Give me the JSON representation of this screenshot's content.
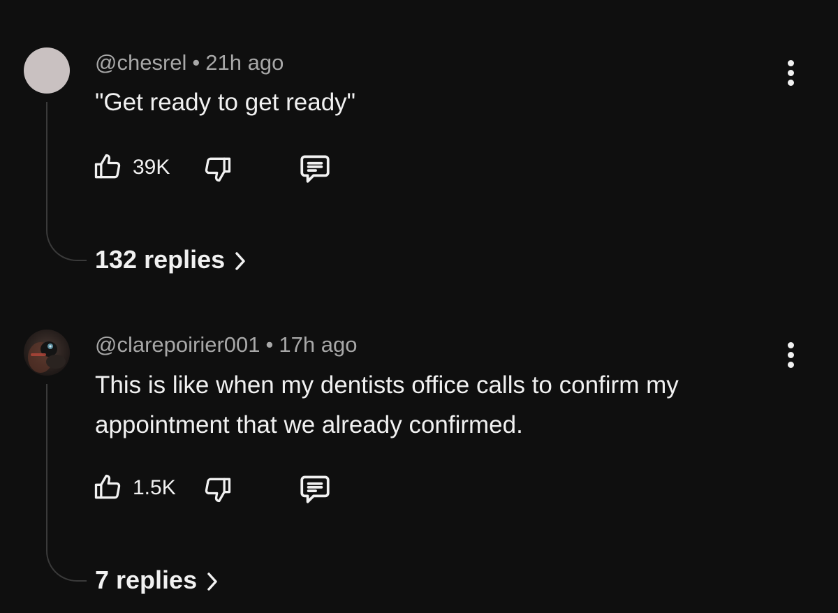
{
  "comments": [
    {
      "author": "@chesrel",
      "separator": "•",
      "time": "21h ago",
      "text": "\"Get ready to get ready\"",
      "likes": "39K",
      "replies_label": "132 replies",
      "avatar": "plain-avatar"
    },
    {
      "author": "@clarepoirier001",
      "separator": "•",
      "time": "17h ago",
      "text": "This is like when my dentists office calls to confirm my appointment that we already confirmed.",
      "likes": "1.5K",
      "replies_label": "7 replies",
      "avatar": "photo-avatar"
    }
  ],
  "icons": {
    "like": "thumbs-up-icon",
    "dislike": "thumbs-down-icon",
    "reply": "comment-icon",
    "more": "more-vertical-icon",
    "expand": "chevron-right-icon"
  },
  "colors": {
    "background": "#0f0f0f",
    "text": "#f1f1f1",
    "meta": "#a8a8a8",
    "thread_line": "#3a3a3a"
  }
}
